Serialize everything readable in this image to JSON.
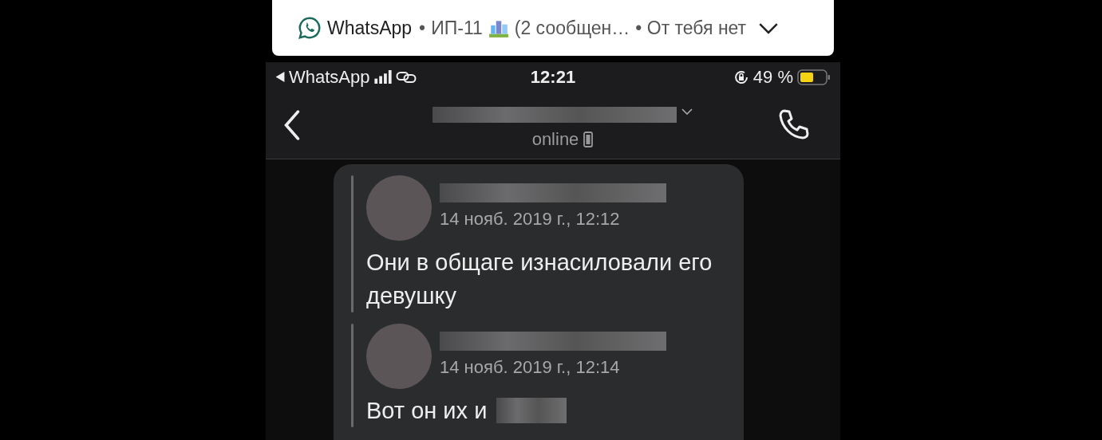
{
  "notification": {
    "app": "WhatsApp",
    "separator": "•",
    "chat": "ИП-11",
    "preview": "(2 сообщен…",
    "tail": "• От тебя нет"
  },
  "status_bar": {
    "back_app": "WhatsApp",
    "time": "12:21",
    "battery": "49 %"
  },
  "header": {
    "status": "online"
  },
  "messages": [
    {
      "date": "14 нояб. 2019 г., 12:12",
      "text": "Они в общаге изнасиловали его девушку",
      "redacted_tail": false
    },
    {
      "date": "14 нояб. 2019 г., 12:14",
      "text": "Вот он их и",
      "redacted_tail": true
    }
  ]
}
